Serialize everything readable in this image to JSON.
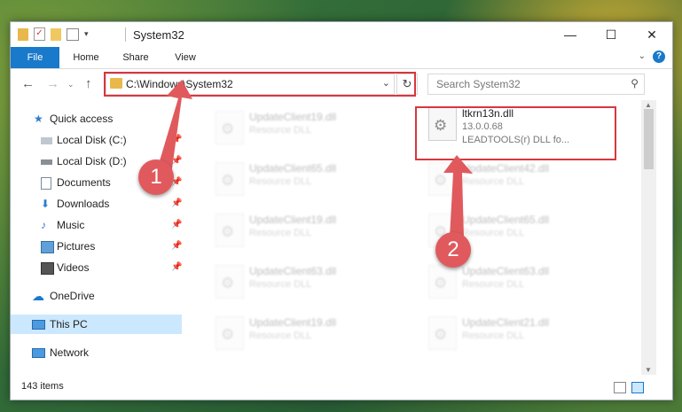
{
  "window": {
    "title": "System32",
    "controls": {
      "minimize": "—",
      "maximize": "☐",
      "close": "✕"
    }
  },
  "ribbon": {
    "tabs": [
      "File",
      "Home",
      "Share",
      "View"
    ],
    "help": "?"
  },
  "nav": {
    "address": "C:\\Windows\\System32",
    "search_placeholder": "Search System32"
  },
  "sidebar": {
    "items": [
      {
        "label": "Quick access",
        "icon": "star-icon"
      },
      {
        "label": "Local Disk (C:)",
        "icon": "drive-icon",
        "pinned": true
      },
      {
        "label": "Local Disk (D:)",
        "icon": "drive-icon",
        "pinned": true
      },
      {
        "label": "Documents",
        "icon": "documents-icon",
        "pinned": true
      },
      {
        "label": "Downloads",
        "icon": "downloads-icon",
        "pinned": true
      },
      {
        "label": "Music",
        "icon": "music-icon",
        "pinned": true
      },
      {
        "label": "Pictures",
        "icon": "pictures-icon",
        "pinned": true
      },
      {
        "label": "Videos",
        "icon": "videos-icon",
        "pinned": true
      },
      {
        "label": "OneDrive",
        "icon": "onedrive-icon"
      },
      {
        "label": "This PC",
        "icon": "computer-icon",
        "selected": true
      },
      {
        "label": "Network",
        "icon": "network-icon"
      }
    ]
  },
  "files": {
    "left": [
      {
        "name": "UpdateClient19.dll",
        "type": "Resource DLL"
      },
      {
        "name": "UpdateClient65.dll",
        "type": "Resource DLL"
      },
      {
        "name": "UpdateClient19.dll",
        "type": "Resource DLL"
      },
      {
        "name": "UpdateClient63.dll",
        "type": "Resource DLL"
      },
      {
        "name": "UpdateClient19.dll",
        "type": "Resource DLL"
      }
    ],
    "right": [
      {
        "name": "ltkrn13n.dll",
        "version": "13.0.0.68",
        "type": "LEADTOOLS(r) DLL fo..."
      },
      {
        "name": "UpdateClient42.dll",
        "type": "Resource DLL"
      },
      {
        "name": "UpdateClient65.dll",
        "type": "Resource DLL"
      },
      {
        "name": "UpdateClient63.dll",
        "type": "Resource DLL"
      },
      {
        "name": "UpdateClient21.dll",
        "type": "Resource DLL"
      }
    ]
  },
  "status": {
    "count": "143 items"
  },
  "annotations": {
    "step1": "1",
    "step2": "2"
  },
  "colors": {
    "accent": "#1979ca",
    "highlight": "#d9363e",
    "badge": "#e05a5d",
    "selected": "#cce8ff"
  }
}
